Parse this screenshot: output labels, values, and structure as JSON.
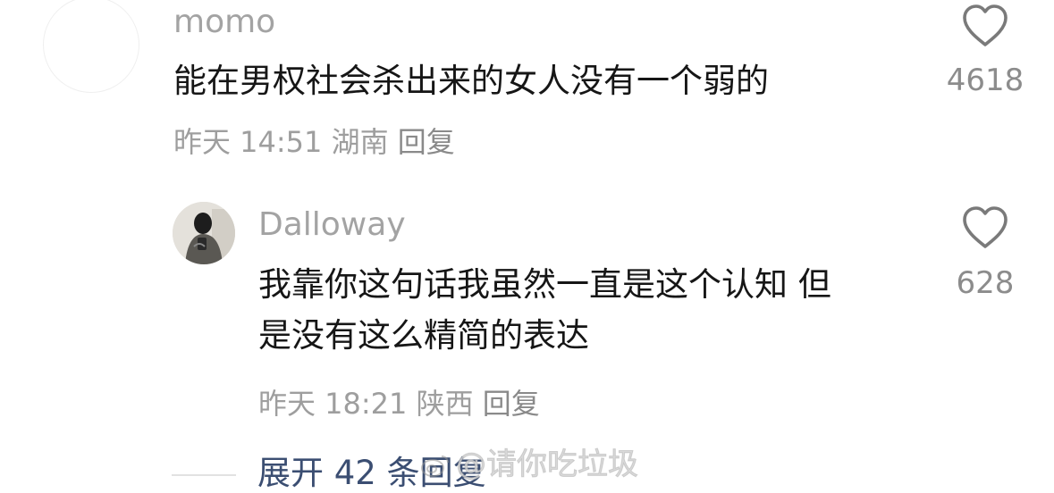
{
  "comments": [
    {
      "username": "momo",
      "text_lines": [
        "能在男权社会杀出来的女人没有一个弱的"
      ],
      "time": "昨天 14:51",
      "location": "湖南",
      "reply_label": "回复",
      "likes": "4618",
      "avatar_icon": "blank-avatar"
    },
    {
      "username": "Dalloway",
      "text_lines": [
        "我靠你这句话我虽然一直是这个认知 但",
        "是没有这么精简的表达"
      ],
      "time": "昨天 18:21",
      "location": "陕西",
      "reply_label": "回复",
      "likes": "628",
      "avatar_icon": "photo-avatar"
    }
  ],
  "expand_replies": "展开 42 条回复",
  "watermark": "@请你吃垃圾",
  "colors": {
    "username": "#a3a3a3",
    "text": "#161616",
    "meta": "#9e9e9e",
    "expand": "#3b4e72",
    "like_icon": "#7a7a7a"
  },
  "icons": {
    "like": "heart-outline-icon",
    "watermark_logo": "weibo-logo-icon"
  }
}
